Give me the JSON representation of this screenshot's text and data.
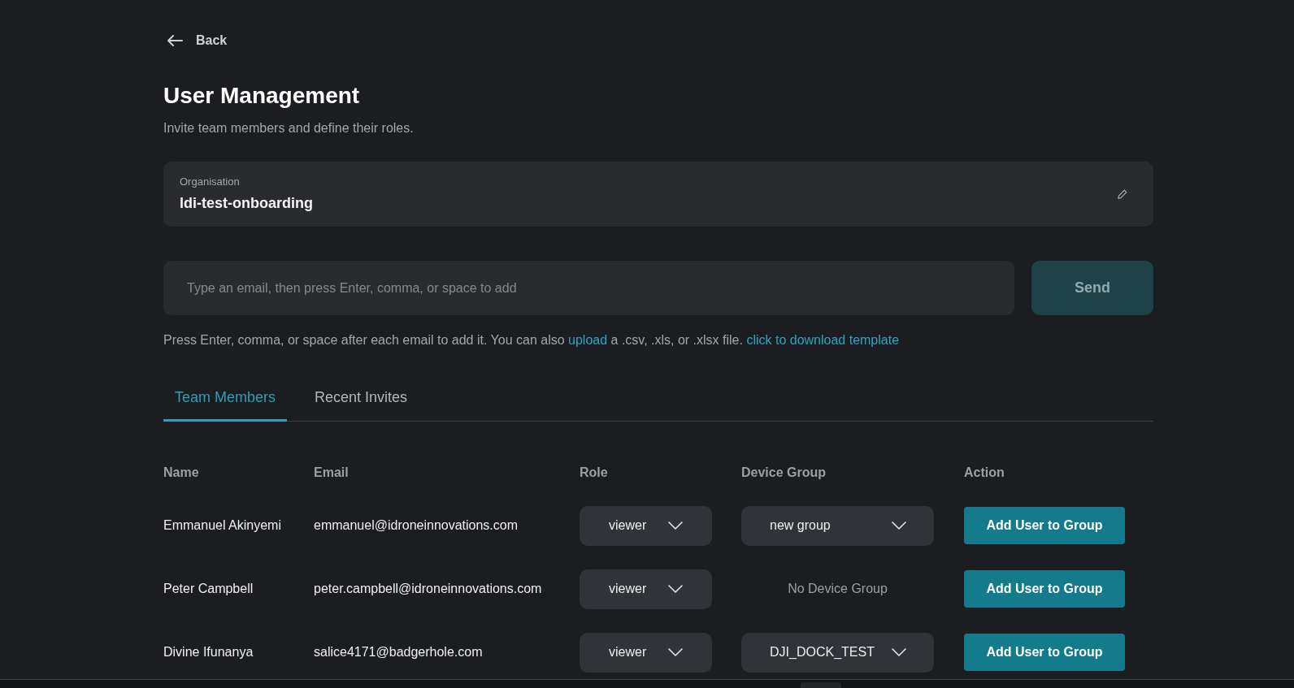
{
  "back": {
    "label": "Back"
  },
  "header": {
    "title": "User Management",
    "subtitle": "Invite team members and define their roles."
  },
  "organisation": {
    "label": "Organisation",
    "value": "ldi-test-onboarding"
  },
  "invite": {
    "placeholder": "Type an email, then press Enter, comma, or space to add",
    "send": {
      "label": "Send",
      "disabled": true
    },
    "help": [
      {
        "kind": "text",
        "text": "Press Enter, comma, or space after each email to add it. You can also "
      },
      {
        "kind": "link",
        "text": "upload"
      },
      {
        "kind": "text",
        "text": " a .csv, .xls, or .xlsx file. "
      },
      {
        "kind": "link",
        "text": "click to download template"
      }
    ]
  },
  "tabs": [
    {
      "label": "Team Members",
      "selected": true
    },
    {
      "label": "Recent Invites",
      "selected": false
    }
  ],
  "table": {
    "columns": [
      "Name",
      "Email",
      "Role",
      "Device Group",
      "Action"
    ],
    "rows": [
      {
        "name": "Emmanuel Akinyemi",
        "email": "emmanuel@idroneinnovations.com",
        "role": "viewer",
        "device_group": {
          "kind": "select",
          "text": "new group"
        },
        "action": "Add User to Group"
      },
      {
        "name": "Peter Campbell",
        "email": "peter.campbell@idroneinnovations.com",
        "role": "viewer",
        "device_group": {
          "kind": "none",
          "text": "No Device Group"
        },
        "action": "Add User to Group"
      },
      {
        "name": "Divine Ifunanya",
        "email": "salice4171@badgerhole.com",
        "role": "viewer",
        "device_group": {
          "kind": "select",
          "text": "DJI_DOCK_TEST"
        },
        "action": "Add User to Group"
      }
    ]
  }
}
